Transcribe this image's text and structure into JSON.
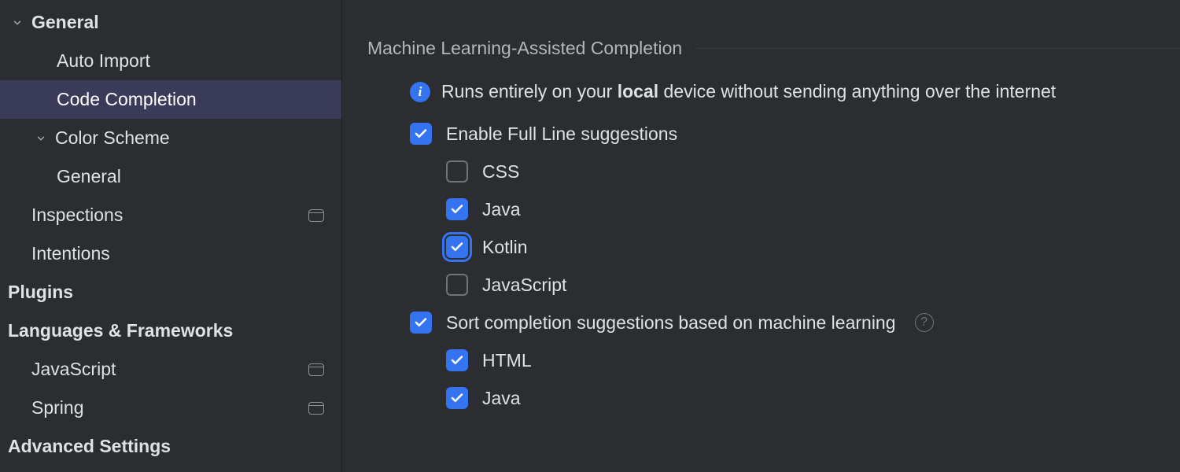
{
  "sidebar": {
    "items": [
      {
        "label": "General",
        "depth": 0,
        "expandable": true,
        "expanded": true,
        "selected": false,
        "badge": false
      },
      {
        "label": "Auto Import",
        "depth": 2,
        "expandable": false,
        "selected": false,
        "badge": false
      },
      {
        "label": "Code Completion",
        "depth": 2,
        "expandable": false,
        "selected": true,
        "badge": false
      },
      {
        "label": "Color Scheme",
        "depth": 1,
        "expandable": true,
        "expanded": true,
        "selected": false,
        "badge": false
      },
      {
        "label": "General",
        "depth": 2,
        "expandable": false,
        "selected": false,
        "badge": false
      },
      {
        "label": "Inspections",
        "depth": 1,
        "expandable": false,
        "selected": false,
        "badge": true
      },
      {
        "label": "Intentions",
        "depth": 1,
        "expandable": false,
        "selected": false,
        "badge": false
      },
      {
        "label": "Plugins",
        "depth": 0,
        "expandable": false,
        "selected": false,
        "badge": false
      },
      {
        "label": "Languages & Frameworks",
        "depth": 0,
        "expandable": false,
        "selected": false,
        "badge": false
      },
      {
        "label": "JavaScript",
        "depth": 1,
        "expandable": false,
        "selected": false,
        "badge": true
      },
      {
        "label": "Spring",
        "depth": 1,
        "expandable": false,
        "selected": false,
        "badge": true
      },
      {
        "label": "Advanced Settings",
        "depth": 0,
        "expandable": false,
        "selected": false,
        "badge": false
      }
    ]
  },
  "content": {
    "section_title": "Machine Learning-Assisted Completion",
    "info_prefix": "Runs entirely on your ",
    "info_bold": "local",
    "info_suffix": " device without sending anything over the internet",
    "full_line_label": "Enable Full Line suggestions",
    "full_line_checked": true,
    "langs": [
      {
        "label": "CSS",
        "checked": false,
        "focus": false
      },
      {
        "label": "Java",
        "checked": true,
        "focus": false
      },
      {
        "label": "Kotlin",
        "checked": true,
        "focus": true
      },
      {
        "label": "JavaScript",
        "checked": false,
        "focus": false
      }
    ],
    "sort_label": "Sort completion suggestions based on machine learning",
    "sort_checked": true,
    "sort_langs": [
      {
        "label": "HTML",
        "checked": true
      },
      {
        "label": "Java",
        "checked": true
      }
    ]
  }
}
